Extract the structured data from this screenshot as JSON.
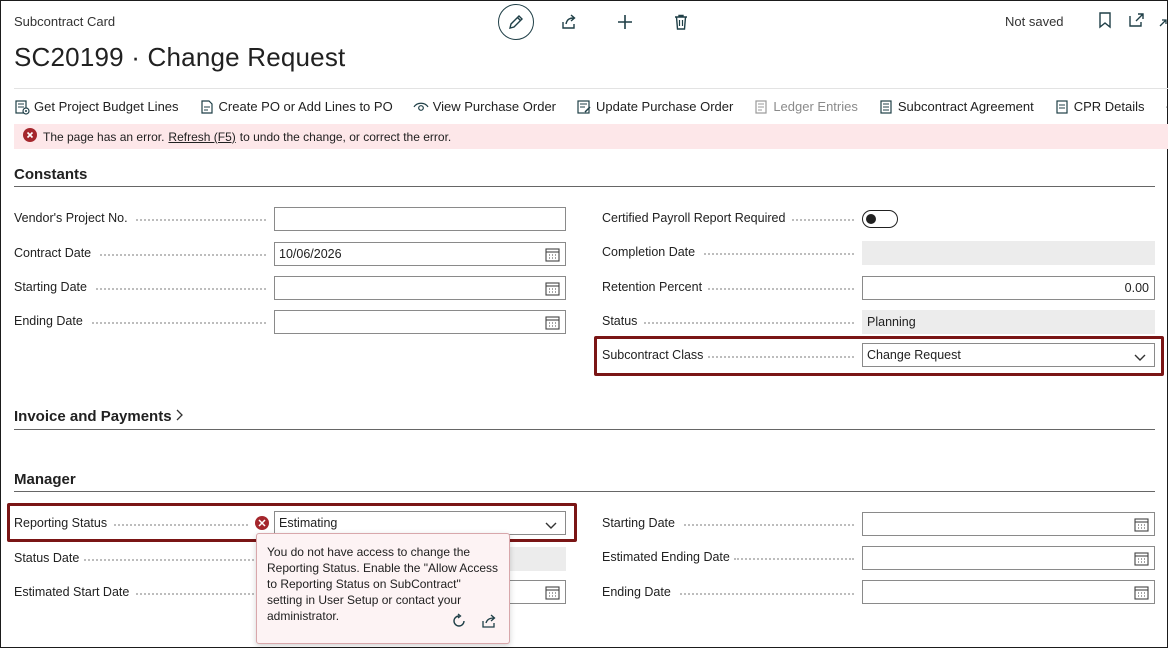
{
  "header": {
    "card_type": "Subcontract Card",
    "title": "SC20199 · Change Request",
    "save_state": "Not saved",
    "icons": [
      "edit-icon",
      "share-icon",
      "add-icon",
      "delete-icon",
      "bookmark-icon",
      "open-new-window-icon"
    ]
  },
  "toolbar": {
    "get_budget_lines": "Get Project Budget Lines",
    "create_po": "Create PO or Add Lines to PO",
    "view_po": "View Purchase Order",
    "update_po": "Update Purchase Order",
    "ledger_entries": "Ledger Entries",
    "subcontract_agreement": "Subcontract Agreement",
    "cpr_details": "CPR Details",
    "more": "…"
  },
  "error_bar": {
    "before": "The page has an error.",
    "link": "Refresh (F5)",
    "after": "to undo the change, or correct the error."
  },
  "constants": {
    "title": "Constants",
    "vendor_project_no": {
      "label": "Vendor's Project No.",
      "value": ""
    },
    "contract_date": {
      "label": "Contract Date",
      "value": "10/06/2026"
    },
    "starting_date": {
      "label": "Starting Date",
      "value": ""
    },
    "ending_date": {
      "label": "Ending Date",
      "value": ""
    },
    "certified_payroll": {
      "label": "Certified Payroll Report Required",
      "value": "off"
    },
    "completion_date": {
      "label": "Completion Date",
      "value": ""
    },
    "retention_percent": {
      "label": "Retention Percent",
      "value": "0.00"
    },
    "status": {
      "label": "Status",
      "value": "Planning"
    },
    "subcontract_class": {
      "label": "Subcontract Class",
      "value": "Change Request"
    }
  },
  "invoice_payments": {
    "title": "Invoice and Payments"
  },
  "manager": {
    "title": "Manager",
    "reporting_status": {
      "label": "Reporting Status",
      "value": "Estimating"
    },
    "status_date": {
      "label": "Status Date",
      "value": ""
    },
    "estimated_start_date": {
      "label": "Estimated Start Date",
      "value": ""
    },
    "starting_date": {
      "label": "Starting Date",
      "value": ""
    },
    "estimated_ending_date": {
      "label": "Estimated Ending Date",
      "value": ""
    },
    "ending_date": {
      "label": "Ending Date",
      "value": ""
    }
  },
  "tooltip": {
    "message": "You do not have access to change the Reporting Status. Enable the \"Allow Access to Reporting Status on SubContract\" setting in User Setup or contact your administrator."
  },
  "colors": {
    "error_bg": "#fde7e9",
    "error_icon": "#a4262c",
    "highlight_border": "#7a1515",
    "readonly_bg": "#ececec"
  }
}
